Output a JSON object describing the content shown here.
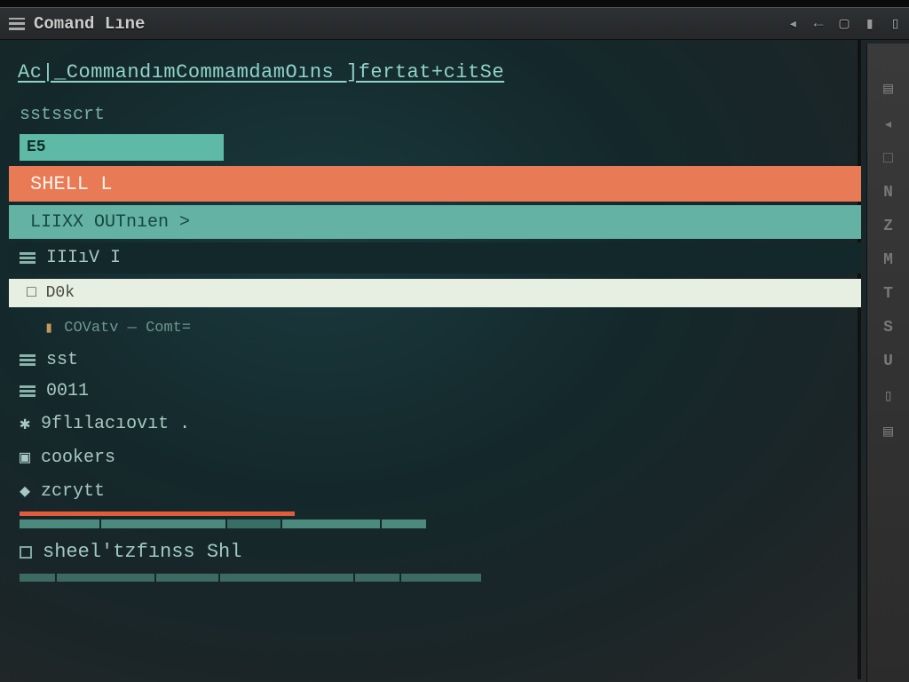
{
  "titlebar": {
    "title": "Comand Lıne",
    "right_glyphs": [
      "◂",
      "←",
      "▢",
      "▮",
      "▯"
    ]
  },
  "sidebar": {
    "items": [
      "▤",
      "◂",
      "□",
      "N",
      "Z",
      "M",
      "T",
      "S",
      "U",
      "▯",
      "▤"
    ]
  },
  "breadcrumb": "Ac|_CommandımCommamdamOıns ]fertat+citSe",
  "label_script": "sstsscrt",
  "bar_green_label": "E5",
  "bar_orange_label": "SHELL L",
  "bar_teal_label": "LIIXX OUTnıen >",
  "row_iiivi": "IIIıV I",
  "input_placeholder": "□ D0k",
  "list": {
    "items": [
      {
        "icon": "file",
        "label": "COVatv — Comt="
      },
      {
        "icon": "list",
        "label": "sst"
      },
      {
        "icon": "list",
        "label": "0011"
      },
      {
        "icon": "gear",
        "label": "9flılacıovıt ."
      },
      {
        "icon": "box",
        "label": "cookers"
      },
      {
        "icon": "shield",
        "label": "zcrytt"
      }
    ]
  },
  "footer_row": "sheel'tzfınss Shl",
  "colors": {
    "accent_orange": "#e97a56",
    "accent_teal": "#64b2a3",
    "bg": "#14282b"
  }
}
